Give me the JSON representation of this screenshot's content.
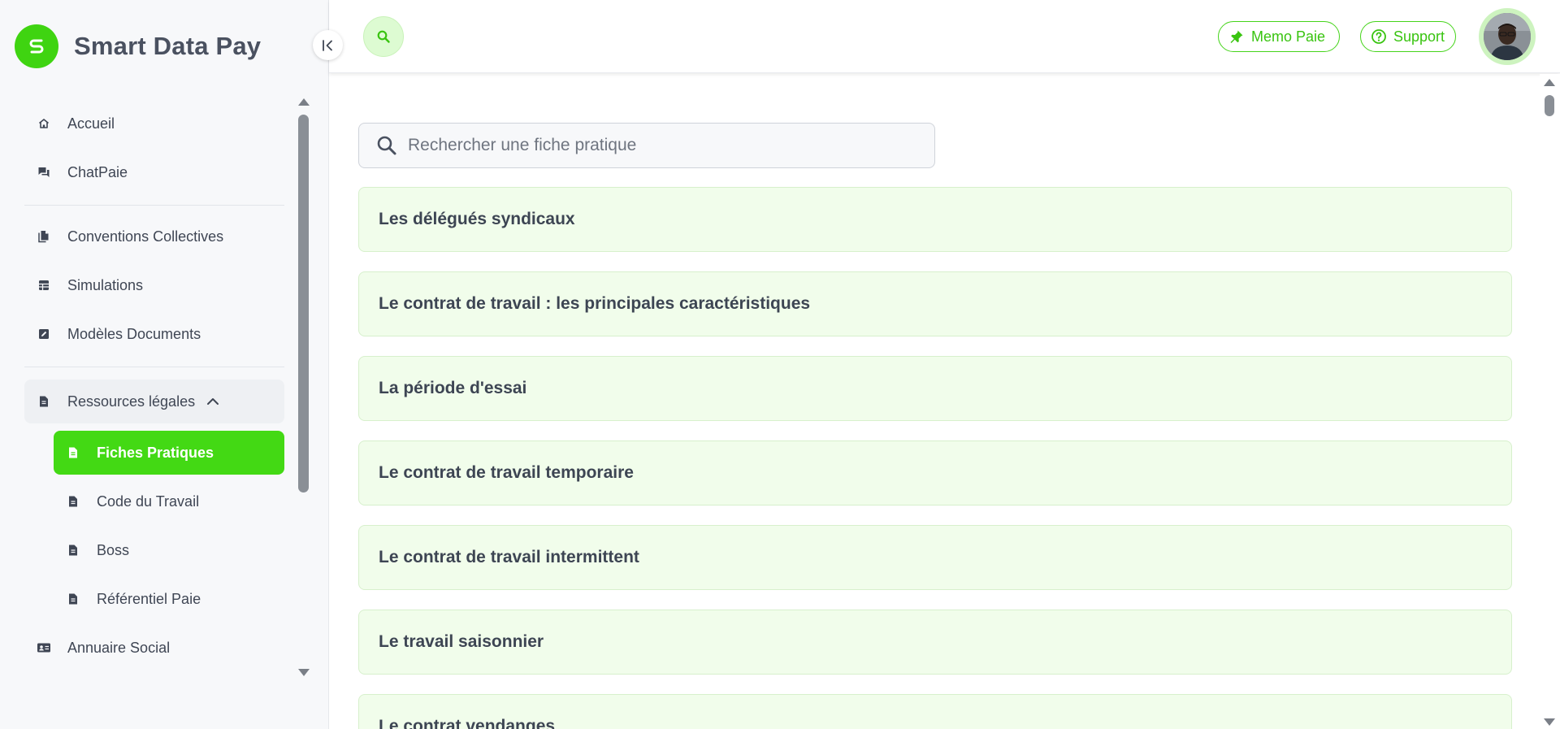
{
  "brand": {
    "name": "Smart Data Pay"
  },
  "colors": {
    "accent": "#43d914",
    "accent_dark": "#39c410",
    "card_bg": "#f1fdeb"
  },
  "header": {
    "memo_label": "Memo Paie",
    "support_label": "Support"
  },
  "sidebar": {
    "items": [
      {
        "label": "Accueil",
        "icon": "home-icon"
      },
      {
        "label": "ChatPaie",
        "icon": "chat-icon"
      },
      {
        "label": "Conventions Collectives",
        "icon": "documents-icon"
      },
      {
        "label": "Simulations",
        "icon": "grid-icon"
      },
      {
        "label": "Modèles Documents",
        "icon": "edit-document-icon"
      },
      {
        "label": "Ressources légales",
        "icon": "document-icon",
        "expanded": true
      },
      {
        "label": "Annuaire Social",
        "icon": "contact-card-icon"
      }
    ],
    "sub_items": [
      {
        "label": "Fiches Pratiques",
        "active": true
      },
      {
        "label": "Code du Travail"
      },
      {
        "label": "Boss"
      },
      {
        "label": "Référentiel Paie"
      }
    ]
  },
  "search": {
    "placeholder": "Rechercher une fiche pratique"
  },
  "fiches": [
    "Les délégués syndicaux",
    "Le contrat de travail : les principales caractéristiques",
    "La période d'essai",
    "Le contrat de travail temporaire",
    "Le contrat de travail intermittent",
    "Le travail saisonnier",
    "Le contrat vendanges"
  ]
}
